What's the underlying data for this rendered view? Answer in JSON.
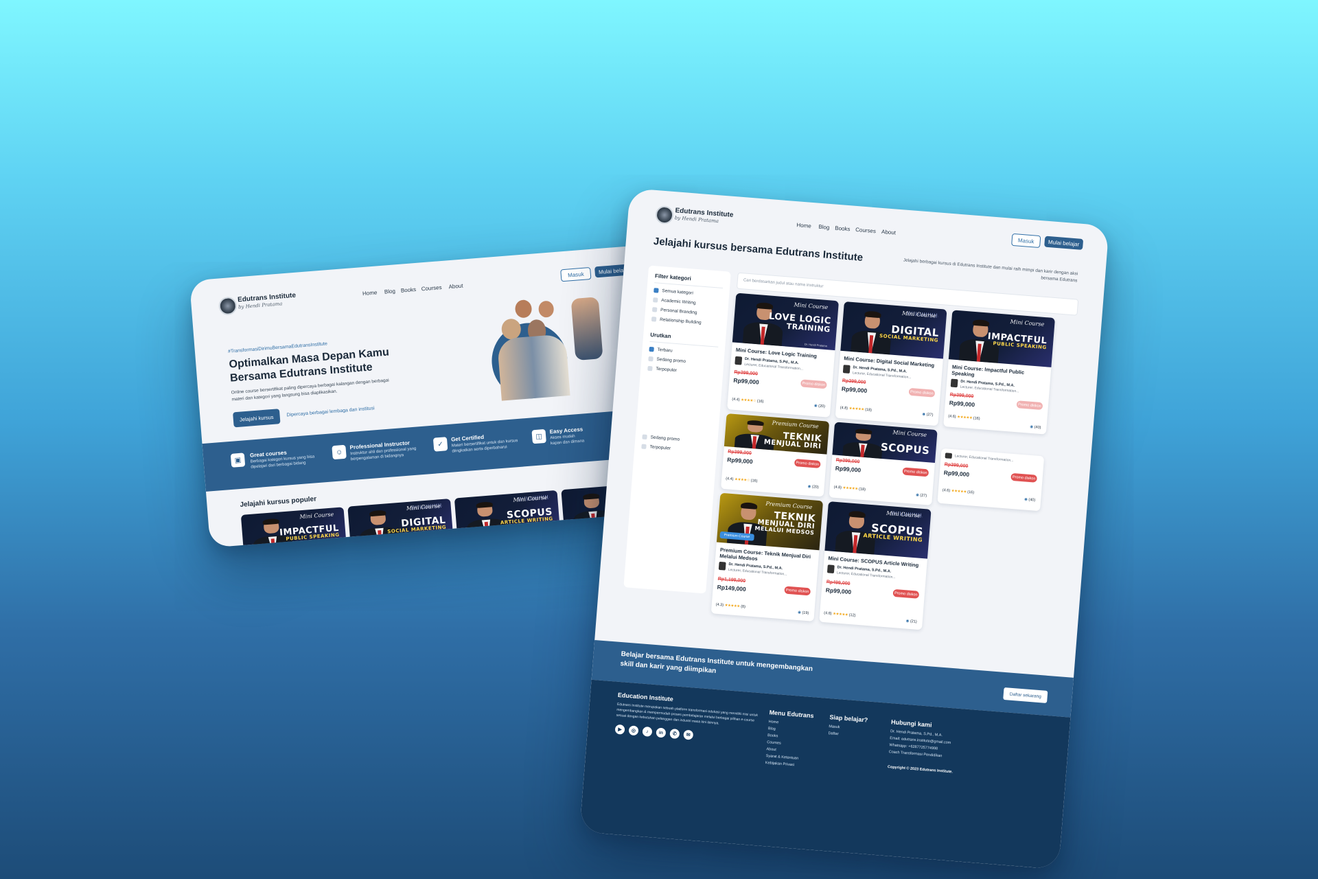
{
  "brand": {
    "name": "Edutrans Institute",
    "tagline": "by Hendi Pratama"
  },
  "nav": {
    "home": "Home",
    "blog": "Blog",
    "books": "Books",
    "courses": "Courses",
    "about": "About",
    "login": "Masuk",
    "start": "Mulai belajar"
  },
  "home": {
    "hashtag": "#TransformasiDirimuBersamaEdutransInstitute",
    "headline_1": "Optimalkan Masa Depan Kamu",
    "headline_2": "Bersama Edutrans Institute",
    "desc_1": "Online course bersertifikat paling dipercaya berbagai kalangan dengan berbagai",
    "desc_2": "materi dan kategori yang langsung bisa diaplikasikan.",
    "cta": "Jelajahi kursus",
    "trusted": "Dipercaya berbagai lembaga dan institusi",
    "features": [
      {
        "title": "Great courses",
        "desc_1": "Berbagai kategori kursus yang bisa",
        "desc_2": "dipelajari dari berbagai bidang"
      },
      {
        "title": "Professional Instructor",
        "desc_1": "Instruktur ahli dan professional yang",
        "desc_2": "berpengalaman di bidangnya"
      },
      {
        "title": "Get Certified",
        "desc_1": "Materi bersertifikat untuk dan kursus",
        "desc_2": "diingkatkan serta diperbaharui"
      },
      {
        "title": "Easy Access",
        "desc_1": "Akses mudah",
        "desc_2": "kapan dan dimana"
      }
    ],
    "popular_title": "Jelajahi kursus populer"
  },
  "catalog": {
    "title": "Jelajahi kursus bersama Edutrans Institute",
    "subtitle_1": "Jelajahi berbagai kursus di Edutrans Institute dan mulai raih mimpi dan karir dengan aksi",
    "subtitle_2": "bersama Edutrans",
    "search_placeholder": "Cari berdasarkan judul atau nama instruktur",
    "filter_title": "Filter kategori",
    "categories": [
      "Semua kategori",
      "Academic Writing",
      "Personal Branding",
      "Relationship Building"
    ],
    "sort_title": "Urutkan",
    "sort_options": [
      "Terbaru",
      "Sedang promo",
      "Terpopuler"
    ],
    "sort_options_2": [
      "Sedang promo",
      "Terpopuler"
    ],
    "author": "Dr. Hendi Pratama, S.Pd., M.A.",
    "author_role": "Lecturer, Educational Transformation...",
    "promo_label": "Promo diskon",
    "premium_label": "Premium Course",
    "courses": [
      {
        "title": "Mini Course: Love Logic Training",
        "old": "Rp399,000",
        "price": "Rp99,000",
        "rating": "(4.4)",
        "reviews": "(16)",
        "students": "(20)"
      },
      {
        "title": "Mini Course: Digital Social Marketing",
        "old": "Rp399,000",
        "price": "Rp99,000",
        "rating": "(4.8)",
        "reviews": "(18)",
        "students": "(27)"
      },
      {
        "title": "Mini Course: Impactful Public Speaking",
        "old": "Rp399,000",
        "price": "Rp99,000",
        "rating": "(4.6)",
        "reviews": "(16)",
        "students": "(40)"
      },
      {
        "title": "",
        "old": "Rp399,000",
        "price": "Rp99,000",
        "rating": "(4.4)",
        "reviews": "(16)",
        "students": "(20)"
      },
      {
        "title": "",
        "old": "Rp399,000",
        "price": "Rp99,000",
        "rating": "(4.8)",
        "reviews": "(18)",
        "students": "(27)"
      },
      {
        "title": "",
        "old": "Rp399,000",
        "price": "Rp99,000",
        "rating": "(4.6)",
        "reviews": "(16)",
        "students": "(40)"
      },
      {
        "title": "Premium Course: Teknik Menjual Diri Melalui Medsos",
        "old": "Rp1,199,000",
        "price": "Rp149,000",
        "rating": "(4.3)",
        "reviews": "(8)",
        "students": "(19)"
      },
      {
        "title": "Mini Course: SCOPUS Article Writing",
        "old": "Rp499,000",
        "price": "Rp99,000",
        "rating": "(4.8)",
        "reviews": "(12)",
        "students": "(21)"
      }
    ],
    "thumb_text": {
      "mini": "Mini Course",
      "premium": "Premium Course",
      "love_1": "LOVE LOGIC",
      "love_2": "TRAINING",
      "digital_1": "DIGITAL",
      "digital_2": "SOCIAL MARKETING",
      "impact_1": "IMPACTFUL",
      "impact_2": "PUBLIC SPEAKING",
      "teknik_1": "TEKNIK",
      "teknik_2": "MENJUAL DIRI",
      "teknik_3": "MELALUI MEDSOS",
      "scopus_1": "SCOPUS",
      "scopus_2": "ARTICLE WRITING",
      "author_tag": "Dr. Hendi Pratama"
    }
  },
  "footer": {
    "cta_1": "Belajar bersama Edutrans Institute untuk mengembangkan",
    "cta_2": "skill dan karir yang diimpikan",
    "cta_button": "Daftar sekarang",
    "about_title": "Education Institute",
    "about_1": "Edutrans Institute merupakan sebuah platform transformasi edukasi yang memiliki misi untuk",
    "about_2": "mengembangkan & mempermudah proses pembelajaran melalui berbagai pilihan e-course",
    "about_3": "sesuai dengan kebutuhan pelanggan dan industri masa kini lainnya.",
    "menu_title": "Menu Edutrans",
    "menu": [
      "Home",
      "Blog",
      "Books",
      "Courses",
      "About",
      "Syarat & Ketentuan",
      "Kebijakan Privasi"
    ],
    "ready_title": "Siap belajar?",
    "ready": [
      "Masuk",
      "Daftar"
    ],
    "contact_title": "Hubungi kami",
    "contact": [
      "Dr. Hendi Pratama, S.Pd., M.A.",
      "Email: edutrans.institute@gmail.com",
      "Whatsapp: +6287725774998",
      "Coach Transformasi Pendidikan"
    ],
    "copyright": "Copyright © 2023 Edutrans Institute."
  },
  "colors": {
    "primary": "#2d5f8e",
    "footer": "#13385c",
    "promo": "#e05252",
    "star": "#f3a81b"
  }
}
